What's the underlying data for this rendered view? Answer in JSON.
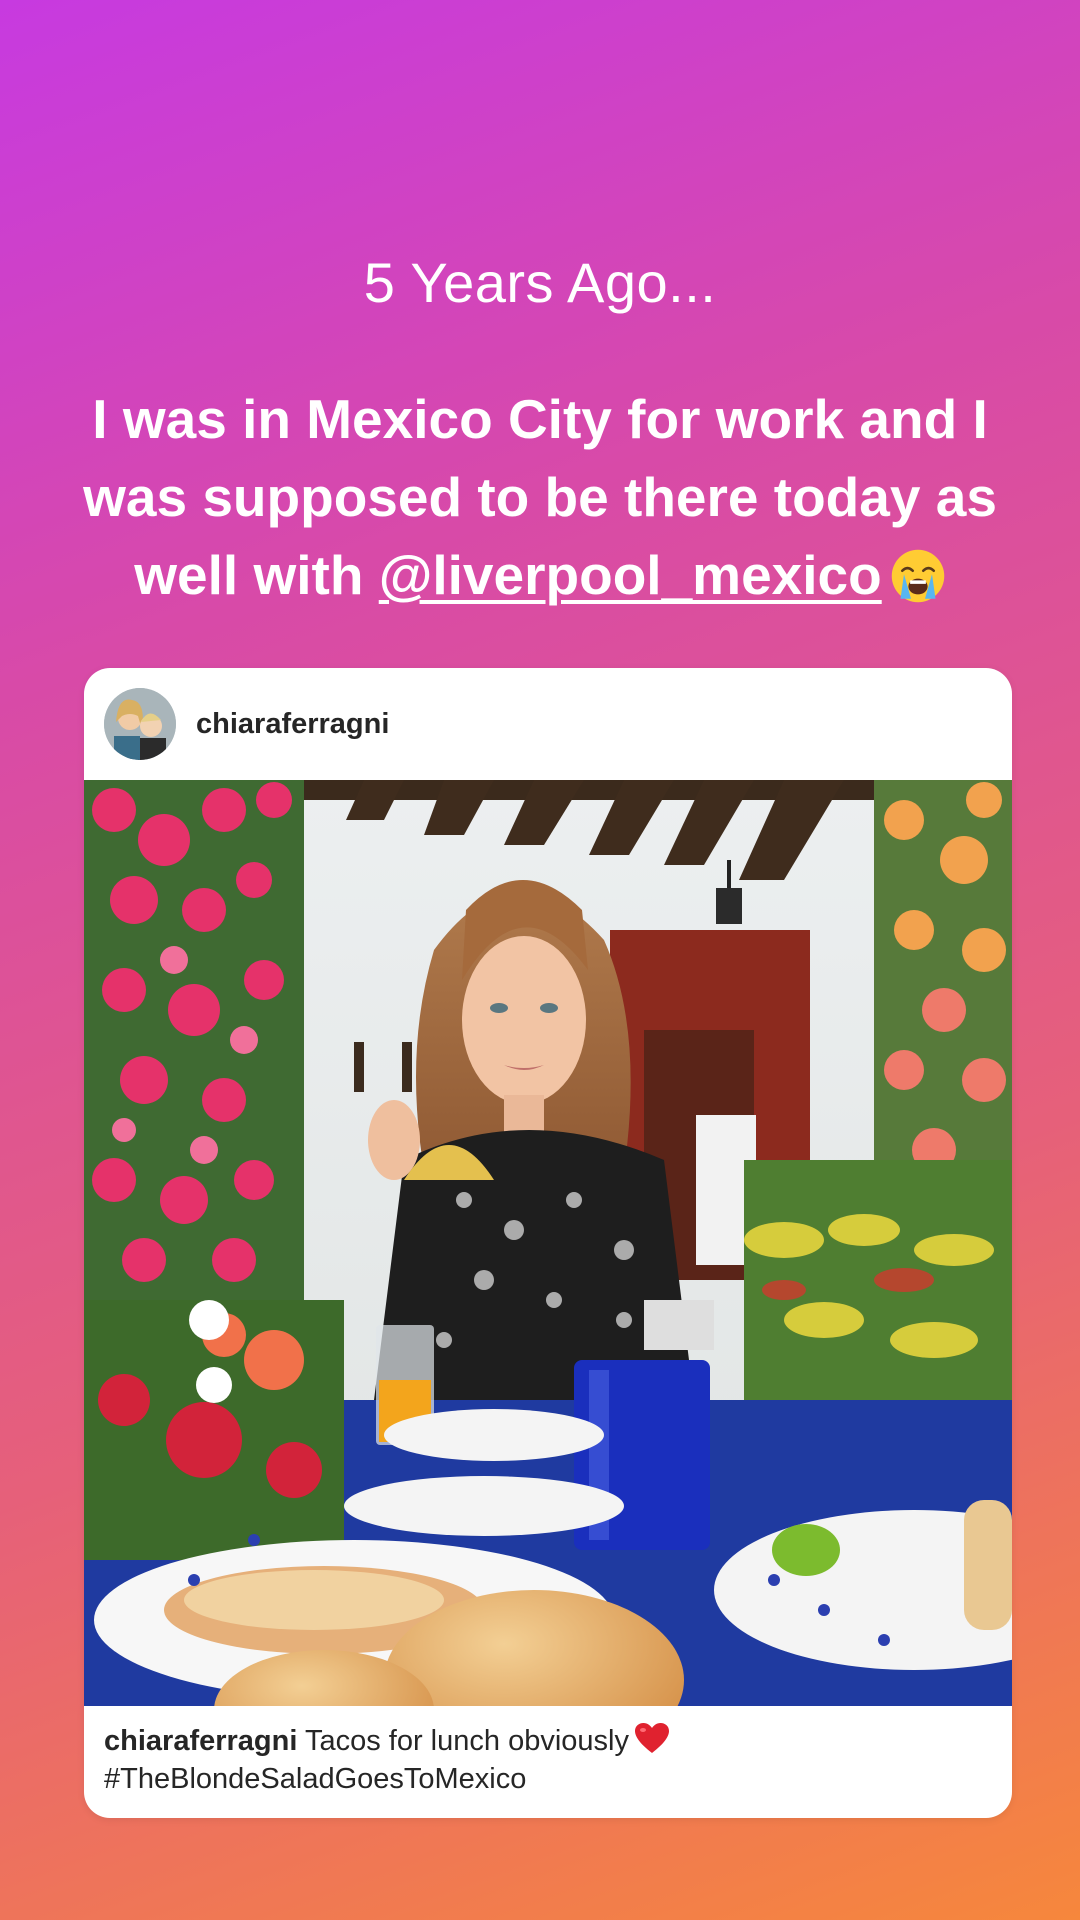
{
  "story": {
    "subtitle": "5 Years Ago...",
    "message_before": "I was in Mexico City for work and I was supposed to be there today as well with ",
    "mention": "@liverpool_mexico",
    "emoji": "loudly-crying-face-emoji"
  },
  "post": {
    "username": "chiaraferragni",
    "caption_user": "chiaraferragni",
    "caption_text": "Tacos for lunch obviously",
    "caption_emoji": "red-heart-emoji",
    "hashtag": "#TheBlondeSaladGoesToMexico"
  },
  "colors": {
    "gradient_start": "#c73ae0",
    "gradient_end": "#f6873c",
    "card_bg": "#ffffff",
    "text_dark": "#262626"
  }
}
